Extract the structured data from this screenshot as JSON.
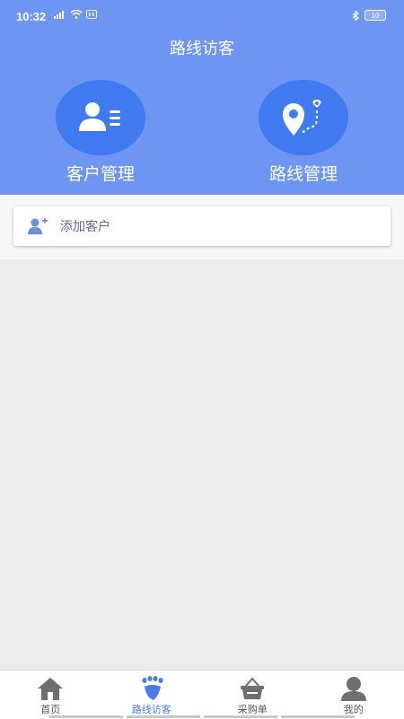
{
  "status": {
    "time": "10:32",
    "battery": "10"
  },
  "header": {
    "title": "路线访客"
  },
  "features": [
    {
      "label": "客户管理",
      "icon": "customer-list-icon"
    },
    {
      "label": "路线管理",
      "icon": "route-pin-icon"
    }
  ],
  "add_customer": {
    "label": "添加客户",
    "icon": "add-user-icon"
  },
  "tabs": [
    {
      "label": "首页",
      "icon": "home-icon",
      "active": false
    },
    {
      "label": "路线访客",
      "icon": "footprint-icon",
      "active": true
    },
    {
      "label": "采购单",
      "icon": "basket-icon",
      "active": false
    },
    {
      "label": "我的",
      "icon": "person-icon",
      "active": false
    }
  ],
  "colors": {
    "header_bg": "#6d95f1",
    "feature_circle": "#3f7af1",
    "active_tab": "#4a7bea",
    "inactive_icon": "#6e6e6e"
  }
}
